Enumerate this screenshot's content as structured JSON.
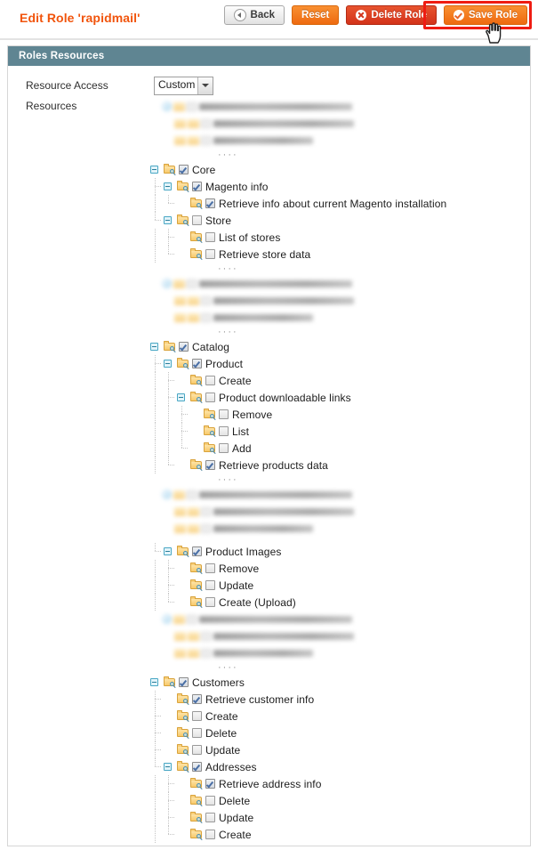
{
  "header": {
    "title": "Edit Role 'rapidmail'",
    "buttons": [
      {
        "name": "back",
        "label": "Back",
        "icon": "back-arrow-icon",
        "style": "grey"
      },
      {
        "name": "reset",
        "label": "Reset",
        "icon": "none",
        "style": "orange"
      },
      {
        "name": "delete-role",
        "label": "Delete Role",
        "icon": "delete-circle-icon",
        "style": "red"
      },
      {
        "name": "save-role",
        "label": "Save Role",
        "icon": "check-circle-icon",
        "style": "orange"
      }
    ],
    "highlight_color": "#ef1c12",
    "title_color": "#f1540c",
    "cursor": "pointer-hand-cursor"
  },
  "panel": {
    "heading": "Roles Resources",
    "heading_bg": "#5f8592",
    "resource_access_label": "Resource Access",
    "resource_access_value": "Custom",
    "resources_label": "Resources"
  },
  "tree": {
    "ellipsis": "····",
    "nodes": [
      {
        "kind": "blurred",
        "rows": [
          {
            "indent": 1,
            "icon": "globe",
            "width": 172
          },
          {
            "indent": 2,
            "icon": "folder",
            "width": 158
          },
          {
            "indent": 2,
            "icon": "folder",
            "width": 112
          }
        ]
      },
      {
        "kind": "dots"
      },
      {
        "kind": "node",
        "depth": 0,
        "label": "Core",
        "checked": true,
        "expandable": true,
        "last": false
      },
      {
        "kind": "node",
        "depth": 1,
        "label": "Magento info",
        "checked": true,
        "expandable": true,
        "last": false
      },
      {
        "kind": "node",
        "depth": 2,
        "label": "Retrieve info about current Magento installation",
        "checked": true,
        "expandable": false,
        "last": true
      },
      {
        "kind": "node",
        "depth": 1,
        "label": "Store",
        "checked": false,
        "expandable": true,
        "last": true
      },
      {
        "kind": "node",
        "depth": 2,
        "label": "List of stores",
        "checked": false,
        "expandable": false,
        "last": false
      },
      {
        "kind": "node",
        "depth": 2,
        "label": "Retrieve store data",
        "checked": false,
        "expandable": false,
        "last": true
      },
      {
        "kind": "dots"
      },
      {
        "kind": "blurred",
        "rows": [
          {
            "indent": 1,
            "icon": "globe",
            "width": 172
          },
          {
            "indent": 2,
            "icon": "folder",
            "width": 158
          },
          {
            "indent": 2,
            "icon": "folder",
            "width": 112
          }
        ]
      },
      {
        "kind": "dots"
      },
      {
        "kind": "node",
        "depth": 0,
        "label": "Catalog",
        "checked": true,
        "expandable": true,
        "last": false
      },
      {
        "kind": "node",
        "depth": 1,
        "label": "Product",
        "checked": true,
        "expandable": true,
        "last": false
      },
      {
        "kind": "node",
        "depth": 2,
        "label": "Create",
        "checked": false,
        "expandable": false,
        "last": false
      },
      {
        "kind": "node",
        "depth": 2,
        "label": "Product downloadable links",
        "checked": false,
        "expandable": true,
        "last": false
      },
      {
        "kind": "node",
        "depth": 3,
        "label": "Remove",
        "checked": false,
        "expandable": false,
        "last": false
      },
      {
        "kind": "node",
        "depth": 3,
        "label": "List",
        "checked": false,
        "expandable": false,
        "last": false
      },
      {
        "kind": "node",
        "depth": 3,
        "label": "Add",
        "checked": false,
        "expandable": false,
        "last": true
      },
      {
        "kind": "node",
        "depth": 2,
        "label": "Retrieve products data",
        "checked": true,
        "expandable": false,
        "last": true
      },
      {
        "kind": "dots"
      },
      {
        "kind": "blurred",
        "rows": [
          {
            "indent": 1,
            "icon": "globe",
            "width": 172
          },
          {
            "indent": 2,
            "icon": "folder",
            "width": 158
          },
          {
            "indent": 2,
            "icon": "folder",
            "width": 112
          }
        ]
      },
      {
        "kind": "spacer"
      },
      {
        "kind": "node",
        "depth": 1,
        "label": "Product Images",
        "checked": true,
        "expandable": true,
        "last": true
      },
      {
        "kind": "node",
        "depth": 2,
        "label": "Remove",
        "checked": false,
        "expandable": false,
        "last": false
      },
      {
        "kind": "node",
        "depth": 2,
        "label": "Update",
        "checked": false,
        "expandable": false,
        "last": false
      },
      {
        "kind": "node",
        "depth": 2,
        "label": "Create (Upload)",
        "checked": false,
        "expandable": false,
        "last": true
      },
      {
        "kind": "blurred",
        "rows": [
          {
            "indent": 1,
            "icon": "globe",
            "width": 172
          },
          {
            "indent": 2,
            "icon": "folder",
            "width": 158
          },
          {
            "indent": 2,
            "icon": "folder",
            "width": 112
          }
        ]
      },
      {
        "kind": "dots"
      },
      {
        "kind": "node",
        "depth": 0,
        "label": "Customers",
        "checked": true,
        "expandable": true,
        "last": true
      },
      {
        "kind": "node",
        "depth": 1,
        "label": "Retrieve customer info",
        "checked": true,
        "expandable": false,
        "last": false
      },
      {
        "kind": "node",
        "depth": 1,
        "label": "Create",
        "checked": false,
        "expandable": false,
        "last": false
      },
      {
        "kind": "node",
        "depth": 1,
        "label": "Delete",
        "checked": false,
        "expandable": false,
        "last": false
      },
      {
        "kind": "node",
        "depth": 1,
        "label": "Update",
        "checked": false,
        "expandable": false,
        "last": false
      },
      {
        "kind": "node",
        "depth": 1,
        "label": "Addresses",
        "checked": true,
        "expandable": true,
        "last": true
      },
      {
        "kind": "node",
        "depth": 2,
        "label": "Retrieve address info",
        "checked": true,
        "expandable": false,
        "last": false
      },
      {
        "kind": "node",
        "depth": 2,
        "label": "Delete",
        "checked": false,
        "expandable": false,
        "last": false
      },
      {
        "kind": "node",
        "depth": 2,
        "label": "Update",
        "checked": false,
        "expandable": false,
        "last": false
      },
      {
        "kind": "node",
        "depth": 2,
        "label": "Create",
        "checked": false,
        "expandable": false,
        "last": true
      }
    ]
  }
}
